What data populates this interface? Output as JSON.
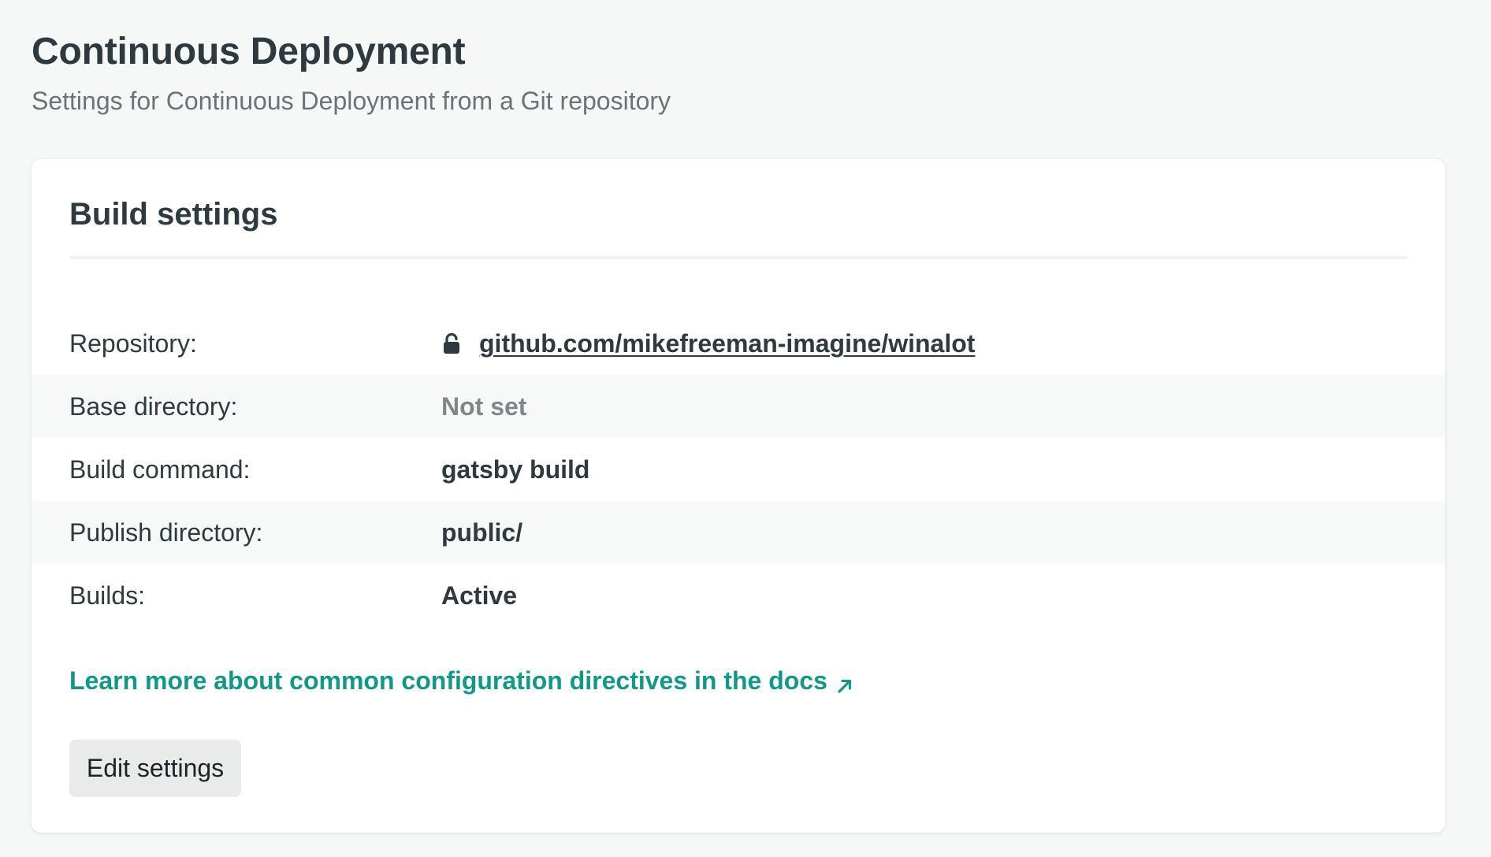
{
  "page": {
    "title": "Continuous Deployment",
    "subtitle": "Settings for Continuous Deployment from a Git repository"
  },
  "build_settings": {
    "title": "Build settings",
    "rows": [
      {
        "label": "Repository:",
        "value": "github.com/mikefreeman-imagine/winalot",
        "icon": "lock-icon"
      },
      {
        "label": "Base directory:",
        "value": "Not set"
      },
      {
        "label": "Build command:",
        "value": "gatsby build"
      },
      {
        "label": "Publish directory:",
        "value": "public/"
      },
      {
        "label": "Builds:",
        "value": "Active"
      }
    ],
    "docs_link": "Learn more about common configuration directives in the docs",
    "docs_link_icon": "external-arrow-icon",
    "edit_button": "Edit settings"
  },
  "colors": {
    "background": "#f6f8f8",
    "card": "#ffffff",
    "text": "#2e3a3f",
    "muted_text": "#7f878b",
    "accent": "#12988a",
    "button_bg": "#e9ebeb"
  }
}
